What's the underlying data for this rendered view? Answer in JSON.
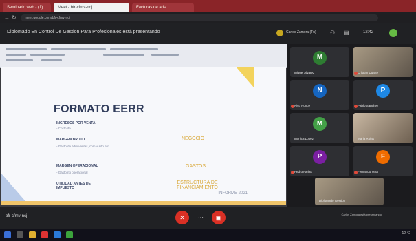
{
  "browser": {
    "tabs": [
      "Seminario web - (1) ...",
      "Meet - bfr-cfmv-ncj",
      "Facturas de ads"
    ],
    "url": "meet.google.com/bfr-cfmv-ncj"
  },
  "meeting": {
    "title": "Diplomado En Control De Gestion Para Profesionales está presentando",
    "presenter_chip": "Carlos Zamora (Tú)"
  },
  "slide": {
    "title": "FORMATO EERR",
    "rows": [
      {
        "label": "INGRESOS POR VENTA",
        "sub": "- Costo de"
      },
      {
        "label": "MARGEN BRUTO",
        "sub": "- Gasto de adm ventas, com + sdo etc"
      },
      {
        "label": "MARGEN OPERACIONAL",
        "sub": "- Gasto no operacional"
      },
      {
        "label": "UTILIDAD ANTES DE IMPUESTO",
        "sub": ""
      }
    ],
    "notes": [
      "NEGOCIO",
      "GASTOS",
      "ESTRUCTURA DE FINANCIAMIENTO"
    ],
    "footer": "INFORME 2021"
  },
  "participants": [
    {
      "initial": "M",
      "name": "Miguel Alvarez",
      "color": "#2e7d32"
    },
    {
      "initial": "",
      "name": "Cristian Duarte",
      "color": "#555"
    },
    {
      "initial": "N",
      "name": "Nico Ponce",
      "color": "#1565c0"
    },
    {
      "initial": "P",
      "name": "Pablo Sanchez",
      "color": "#1e88e5"
    },
    {
      "initial": "M",
      "name": "Monica Lopez",
      "color": "#43a047"
    },
    {
      "initial": "",
      "name": "Maria Rojas",
      "color": "#555"
    },
    {
      "initial": "P",
      "name": "Pedro Farias",
      "color": "#7b1fa2"
    },
    {
      "initial": "F",
      "name": "Fernando Vera",
      "color": "#ef6c00"
    },
    {
      "initial": "",
      "name": "Diplomado Gestion",
      "color": "#555"
    }
  ],
  "controls": {
    "left_text": "bfr-cfmv-ncj",
    "more": "⋯",
    "right_text": "Carlos Zamora está presentando"
  },
  "taskbar": {
    "clock": "12:42"
  }
}
